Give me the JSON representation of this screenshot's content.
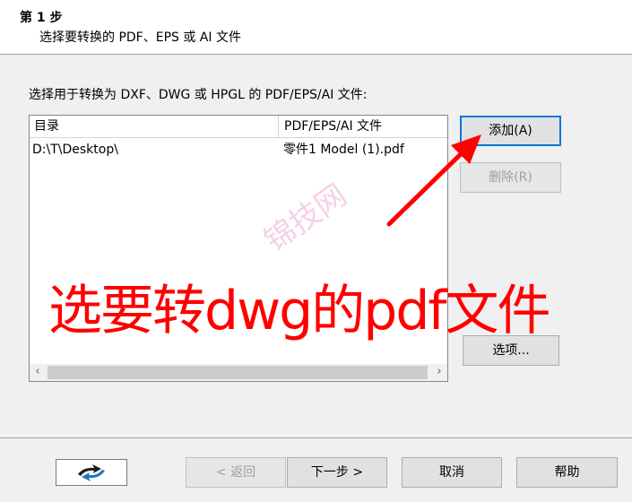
{
  "header": {
    "step_title": "第 1 步",
    "step_subtitle": "选择要转换的 PDF、EPS 或 AI 文件"
  },
  "instruction": "选择用于转换为 DXF、DWG 或 HPGL 的 PDF/EPS/AI 文件:",
  "file_list": {
    "columns": [
      "目录",
      "PDF/EPS/AI 文件"
    ],
    "rows": [
      {
        "directory": "D:\\T\\Desktop\\",
        "file": "零件1 Model (1).pdf"
      }
    ]
  },
  "side_buttons": {
    "add": "添加(A)",
    "remove": "删除(R)",
    "options": "选项..."
  },
  "footer_buttons": {
    "back": "< 返回",
    "next": "下一步 >",
    "cancel": "取消",
    "help": "帮助"
  },
  "annotation": {
    "text": "选要转dwg的pdf文件",
    "color": "#ff0000"
  },
  "watermark": "锦技网"
}
